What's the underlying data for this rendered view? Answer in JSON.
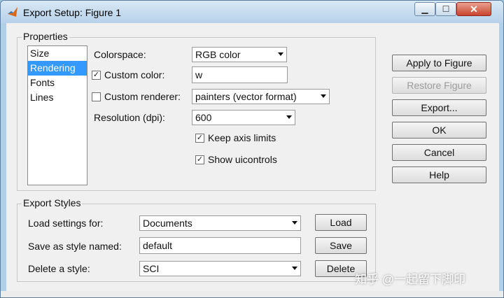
{
  "window": {
    "title": "Export Setup: Figure 1"
  },
  "properties": {
    "legend": "Properties",
    "list": [
      "Size",
      "Rendering",
      "Fonts",
      "Lines"
    ],
    "selected_index": 1,
    "colorspace_label": "Colorspace:",
    "colorspace_value": "RGB color",
    "custom_color_label": "Custom color:",
    "custom_color_checked": true,
    "custom_color_value": "w",
    "custom_renderer_label": "Custom renderer:",
    "custom_renderer_checked": false,
    "custom_renderer_value": "painters (vector format)",
    "resolution_label": "Resolution (dpi):",
    "resolution_value": "600",
    "keep_axis_label": "Keep axis limits",
    "keep_axis_checked": true,
    "show_ui_label": "Show uicontrols",
    "show_ui_checked": true
  },
  "side_buttons": {
    "apply": "Apply to Figure",
    "restore": "Restore Figure",
    "export": "Export...",
    "ok": "OK",
    "cancel": "Cancel",
    "help": "Help"
  },
  "export_styles": {
    "legend": "Export Styles",
    "load_label": "Load settings for:",
    "load_value": "Documents",
    "load_button": "Load",
    "save_label": "Save as style named:",
    "save_value": "default",
    "save_button": "Save",
    "delete_label": "Delete a style:",
    "delete_value": "SCI",
    "delete_button": "Delete"
  },
  "watermark": "知乎 @一起留下脚印"
}
